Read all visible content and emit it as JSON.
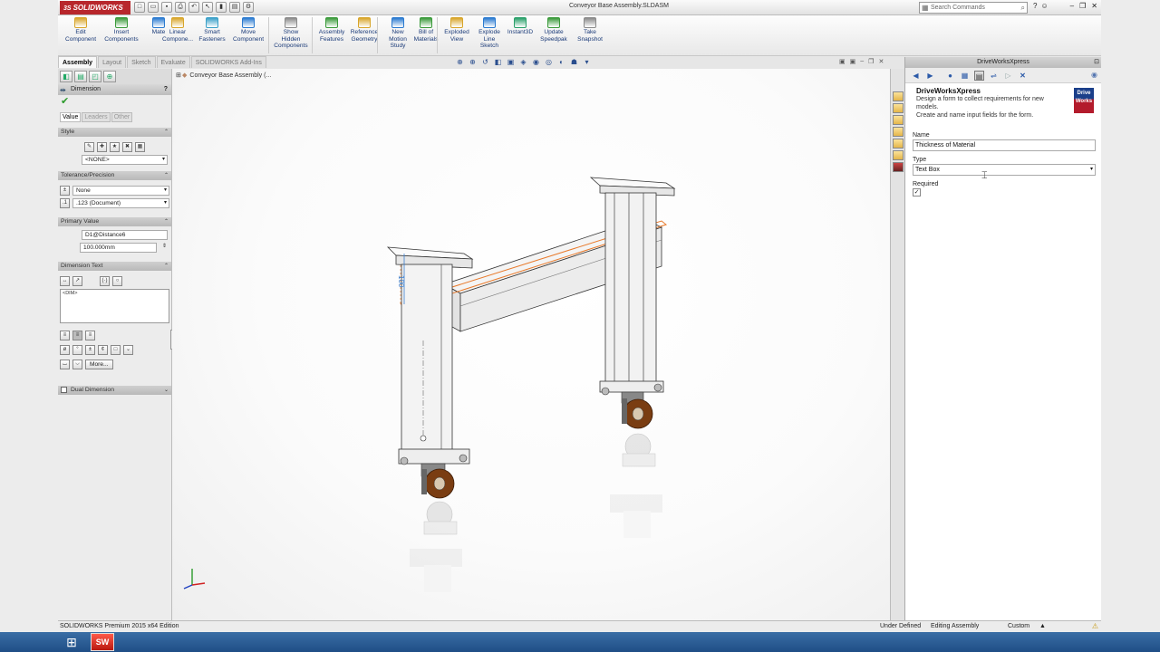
{
  "app": {
    "brand": "SOLIDWORKS",
    "brand_mark": "3S",
    "title": "Conveyor Base Assembly.SLDASM"
  },
  "search": {
    "placeholder": "Search Commands"
  },
  "commands": [
    {
      "label1": "Edit",
      "label2": "Component",
      "label3": ""
    },
    {
      "label1": "Insert",
      "label2": "Components",
      "label3": ""
    },
    {
      "label1": "Mate",
      "label2": "",
      "label3": ""
    },
    {
      "label1": "Linear",
      "label2": "Compone...",
      "label3": ""
    },
    {
      "label1": "Smart",
      "label2": "Fasteners",
      "label3": ""
    },
    {
      "label1": "Move",
      "label2": "Component",
      "label3": ""
    },
    {
      "label1": "Show",
      "label2": "Hidden",
      "label3": "Components"
    },
    {
      "label1": "Assembly",
      "label2": "Features",
      "label3": ""
    },
    {
      "label1": "Reference",
      "label2": "Geometry",
      "label3": ""
    },
    {
      "label1": "New",
      "label2": "Motion",
      "label3": "Study"
    },
    {
      "label1": "Bill of",
      "label2": "Materials",
      "label3": ""
    },
    {
      "label1": "Exploded",
      "label2": "View",
      "label3": ""
    },
    {
      "label1": "Explode",
      "label2": "Line",
      "label3": "Sketch"
    },
    {
      "label1": "Instant3D",
      "label2": "",
      "label3": ""
    },
    {
      "label1": "Update",
      "label2": "Speedpak",
      "label3": ""
    },
    {
      "label1": "Take",
      "label2": "Snapshot",
      "label3": ""
    }
  ],
  "cm_tabs": [
    "Assembly",
    "Layout",
    "Sketch",
    "Evaluate",
    "SOLIDWORKS Add-Ins"
  ],
  "pm": {
    "title": "Dimension",
    "help": "?",
    "subtabs": [
      "Value",
      "Leaders",
      "Other"
    ],
    "style": {
      "header": "Style",
      "value": "<NONE>"
    },
    "tolerance": {
      "header": "Tolerance/Precision",
      "tolerance_type": "None",
      "precision": ".123 (Document)"
    },
    "primary": {
      "header": "Primary Value",
      "name": "D1@Distance6",
      "value": "100.000mm"
    },
    "dimtext": {
      "header": "Dimension Text",
      "text": "<DIM>",
      "more_label": "More..."
    },
    "dual": {
      "header": "Dual Dimension"
    }
  },
  "tree": {
    "node": "Conveyor Base Assembly  (..."
  },
  "model": {
    "dimension_value": "100"
  },
  "dw": {
    "panel_title": "DriveWorksXpress",
    "name": "DriveWorksXpress",
    "desc1": "Design a form to collect requirements for new",
    "desc2": "models.",
    "desc3": "Create and name input fields for the form.",
    "logo_top": "Drive",
    "logo_bottom": "Works",
    "name_label": "Name",
    "name_value": "Thickness of Material",
    "type_label": "Type",
    "type_value": "Text Box",
    "required_label": "Required",
    "required_checked": true
  },
  "status": {
    "edition": "SOLIDWORKS Premium 2015 x64 Edition",
    "state": "Under Defined",
    "mode": "Editing Assembly",
    "units": "Custom",
    "units_arrow": "▲"
  },
  "taskbar": {
    "sw_label": "SW"
  },
  "colors": {
    "brand_red": "#b8272c",
    "selection_orange": "#e8792a",
    "dimension_blue": "#3a7fd0",
    "wheel_brown": "#7a3d12",
    "taskbar_blue": "#2b5d96"
  }
}
